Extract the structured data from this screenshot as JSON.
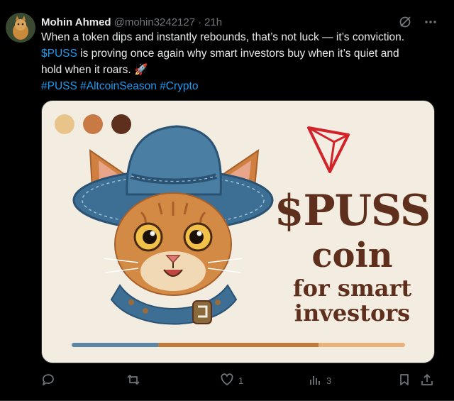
{
  "post": {
    "author_name": "Mohin Ahmed",
    "handle": "@mohin3242127",
    "separator": "·",
    "time": "21h",
    "text": {
      "line1": "When a token dips and instantly rebounds, that’s not luck — it’s conviction.",
      "cashtag": "$PUSS",
      "line2_rest": " is proving once again why smart investors buy when it’s quiet and",
      "line3": "hold when it roars. 🚀",
      "hashtags": [
        "#PUSS",
        "#AltcoinSeason",
        "#Crypto"
      ]
    }
  },
  "media": {
    "title": "$PUSS",
    "subtitle": "coin",
    "tagline1": "for smart",
    "tagline2": "investors",
    "swatches": [
      "#e8c48a",
      "#c97a44",
      "#5e2f1d"
    ],
    "bar_colors": [
      "#5b86a6",
      "#c07a3a",
      "#e8b27a"
    ],
    "logo_color": "#d2232a",
    "background": "#f3ece0"
  },
  "actions": {
    "reply_count": "",
    "repost_count": "",
    "like_count": "1",
    "views_count": "3"
  },
  "icons": [
    "grok-icon",
    "more-icon",
    "reply-icon",
    "repost-icon",
    "like-icon",
    "views-icon",
    "bookmark-icon",
    "share-icon"
  ]
}
